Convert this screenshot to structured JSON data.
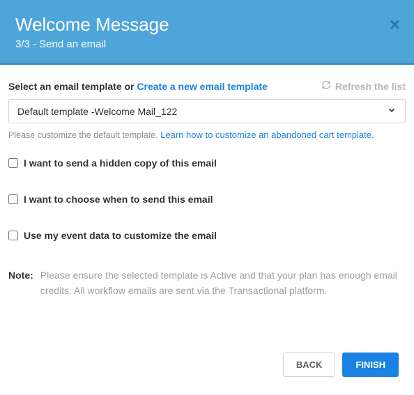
{
  "header": {
    "title": "Welcome Message",
    "subtitle": "3/3 - Send an email"
  },
  "template_select": {
    "label_prefix": "Select an email template or ",
    "create_link": "Create a new email template",
    "refresh_label": "Refresh the list",
    "selected": "Default template -Welcome Mail_122",
    "hint_prefix": "Please customize the default template. ",
    "hint_link": "Learn how to customize an abandoned cart template."
  },
  "checkboxes": [
    {
      "label": "I want to send a hidden copy of this email"
    },
    {
      "label": "I want to choose when to send this email"
    },
    {
      "label": "Use my event data to customize the email"
    }
  ],
  "note": {
    "label": "Note:",
    "text": "Please ensure the selected template is Active and that your plan has enough email credits. All workflow emails are sent via the Transactional platform."
  },
  "buttons": {
    "back": "BACK",
    "finish": "FINISH"
  }
}
